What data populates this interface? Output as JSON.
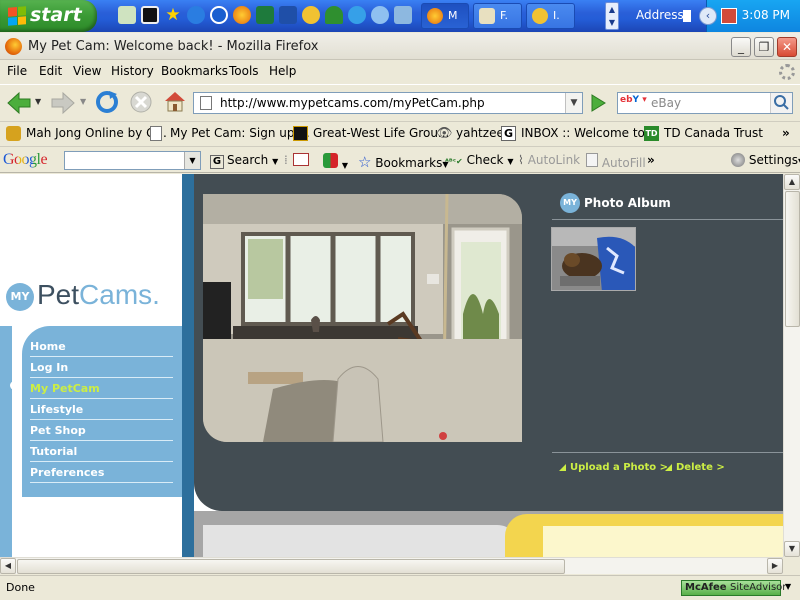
{
  "taskbar": {
    "start_label": "start",
    "tasks": [
      {
        "label": "M",
        "active": true
      },
      {
        "label": "F."
      },
      {
        "label": "I."
      }
    ],
    "address_label": "Address",
    "clock": "3:08 PM"
  },
  "window": {
    "title": "My Pet Cam: Welcome back! - Mozilla Firefox"
  },
  "menu": {
    "file": "File",
    "edit": "Edit",
    "view": "View",
    "history": "History",
    "bookmarks": "Bookmarks",
    "tools": "Tools",
    "help": "Help"
  },
  "nav": {
    "url": "http://www.mypetcams.com/myPetCam.php",
    "search_engine": "eBay",
    "search_placeholder": "eBay"
  },
  "bookmarks": [
    "Mah Jong Online by G...",
    "My Pet Cam: Sign up ...",
    "Great-West Life Grou...",
    "yahtzee",
    "INBOX :: Welcome to ...",
    "TD Canada Trust"
  ],
  "google_toolbar": {
    "logo": "Google",
    "search": "Search",
    "bookmarks": "Bookmarks",
    "check": "Check",
    "autolink": "AutoLink",
    "autofill": "AutoFill",
    "settings": "Settings"
  },
  "page": {
    "logo_badge": "MY",
    "logo_pet": "Pet",
    "logo_cams": "Cams",
    "logo_dot": ".",
    "nav": [
      {
        "label": "Home"
      },
      {
        "label": "Log In"
      },
      {
        "label": "My PetCam",
        "active": true
      },
      {
        "label": "Lifestyle"
      },
      {
        "label": "Pet Shop"
      },
      {
        "label": "Tutorial"
      },
      {
        "label": "Preferences"
      }
    ],
    "album_badge": "MY",
    "album_title": "Photo Album",
    "upload_link": "Upload a Photo >",
    "delete_link": "Delete >"
  },
  "status": {
    "text": "Done",
    "mcafee_brand": "McAfee",
    "mcafee_product": "SiteAdvisor"
  },
  "colors": {
    "page_blue": "#7ab3d9",
    "page_dark": "#434d53",
    "link_lime": "#ccee44",
    "column_blue": "#2d6f9c"
  }
}
